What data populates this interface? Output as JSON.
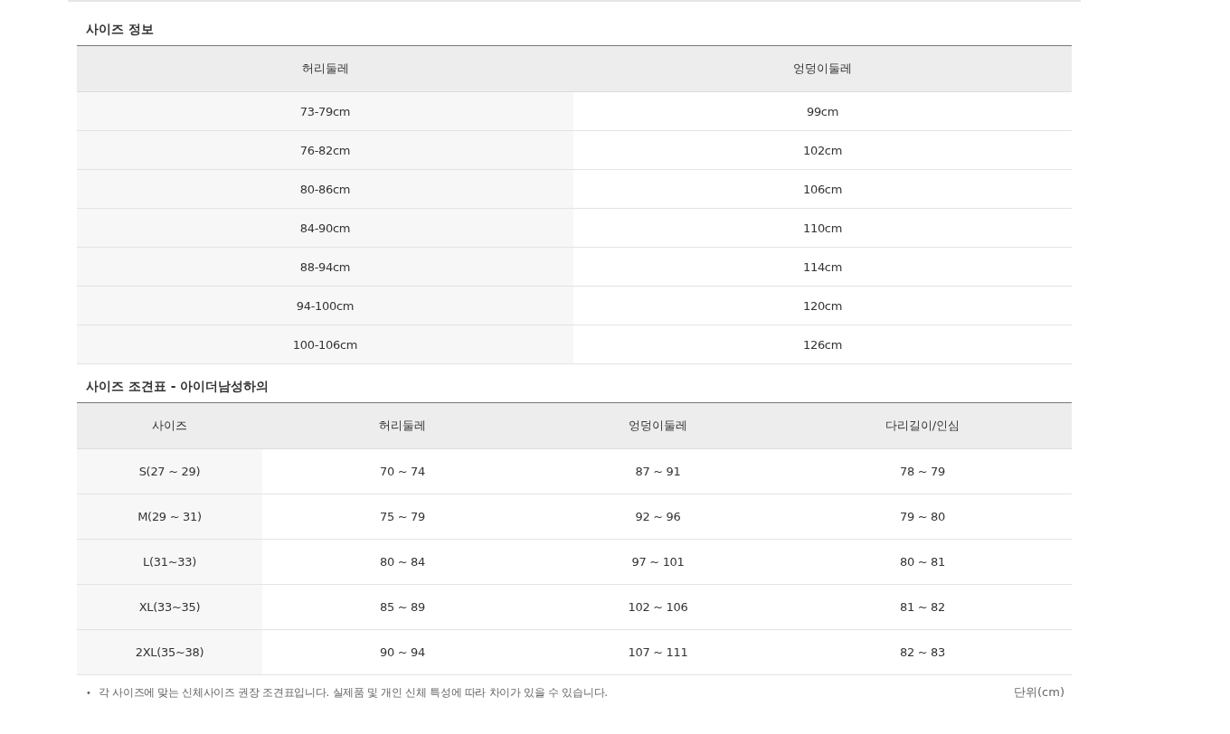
{
  "size_info": {
    "title": "사이즈 정보",
    "columns": [
      "허리둘레",
      "엉덩이둘레"
    ],
    "rows": [
      [
        "73-79cm",
        "99cm"
      ],
      [
        "76-82cm",
        "102cm"
      ],
      [
        "80-86cm",
        "106cm"
      ],
      [
        "84-90cm",
        "110cm"
      ],
      [
        "88-94cm",
        "114cm"
      ],
      [
        "94-100cm",
        "120cm"
      ],
      [
        "100-106cm",
        "126cm"
      ]
    ]
  },
  "size_chart": {
    "title": "사이즈 조견표 - 아이더남성하의",
    "columns": [
      "사이즈",
      "허리둘레",
      "엉덩이둘레",
      "다리길이/인심"
    ],
    "rows": [
      [
        "S(27 ~ 29)",
        "70 ~ 74",
        "87 ~ 91",
        "78 ~ 79"
      ],
      [
        "M(29 ~ 31)",
        "75 ~ 79",
        "92 ~ 96",
        "79 ~ 80"
      ],
      [
        "L(31~33)",
        "80 ~ 84",
        "97 ~ 101",
        "80 ~ 81"
      ],
      [
        "XL(33~35)",
        "85 ~ 89",
        "102 ~ 106",
        "81 ~ 82"
      ],
      [
        "2XL(35~38)",
        "90 ~ 94",
        "107 ~ 111",
        "82 ~ 83"
      ]
    ]
  },
  "footnote": {
    "bullet": "•",
    "text": "각 사이즈에 맞는 신체사이즈 권장 조견표입니다. 실제품 및 개인 신체 특성에 따라 차이가 있을 수 있습니다.",
    "unit": "단위(cm)"
  }
}
